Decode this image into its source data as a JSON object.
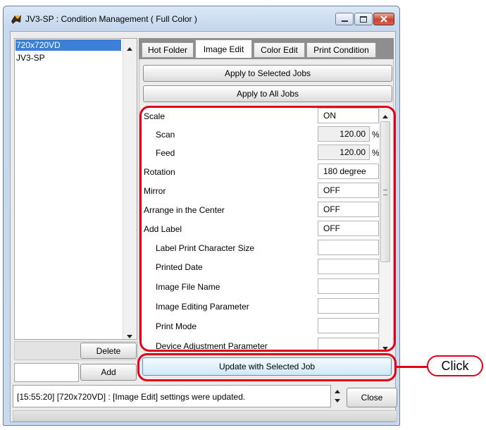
{
  "window": {
    "title": "JV3-SP : Condition Management ( Full Color )"
  },
  "left_list": {
    "items": [
      "720x720VD",
      "JV3-SP"
    ]
  },
  "buttons": {
    "delete": "Delete",
    "add": "Add",
    "close": "Close",
    "apply_selected": "Apply to Selected Jobs",
    "apply_all": "Apply to All Jobs",
    "update_selected": "Update with Selected Job"
  },
  "tabs": [
    "Hot Folder",
    "Image Edit",
    "Color Edit",
    "Print Condition"
  ],
  "active_tab": "Image Edit",
  "properties": [
    {
      "label": "Scale",
      "value": "ON"
    },
    {
      "label": "Scan",
      "value": "120.00",
      "unit": "%"
    },
    {
      "label": "Feed",
      "value": "120.00",
      "unit": "%"
    },
    {
      "label": "Rotation",
      "value": "180 degree"
    },
    {
      "label": "Mirror",
      "value": "OFF"
    },
    {
      "label": "Arrange in the Center",
      "value": "OFF"
    },
    {
      "label": "Add Label",
      "value": "OFF"
    },
    {
      "label": "Label Print Character Size",
      "value": ""
    },
    {
      "label": "Printed Date",
      "value": ""
    },
    {
      "label": "Image File Name",
      "value": ""
    },
    {
      "label": "Image Editing Parameter",
      "value": ""
    },
    {
      "label": "Print Mode",
      "value": ""
    },
    {
      "label": "Device Adjustment Parameter",
      "value": ""
    }
  ],
  "status": {
    "message": "[15:55:20] [720x720VD] : [Image Edit] settings were updated."
  },
  "callout": {
    "text": "Click"
  },
  "colors": {
    "annotation": "#e3001b",
    "selection": "#3b80d6"
  }
}
